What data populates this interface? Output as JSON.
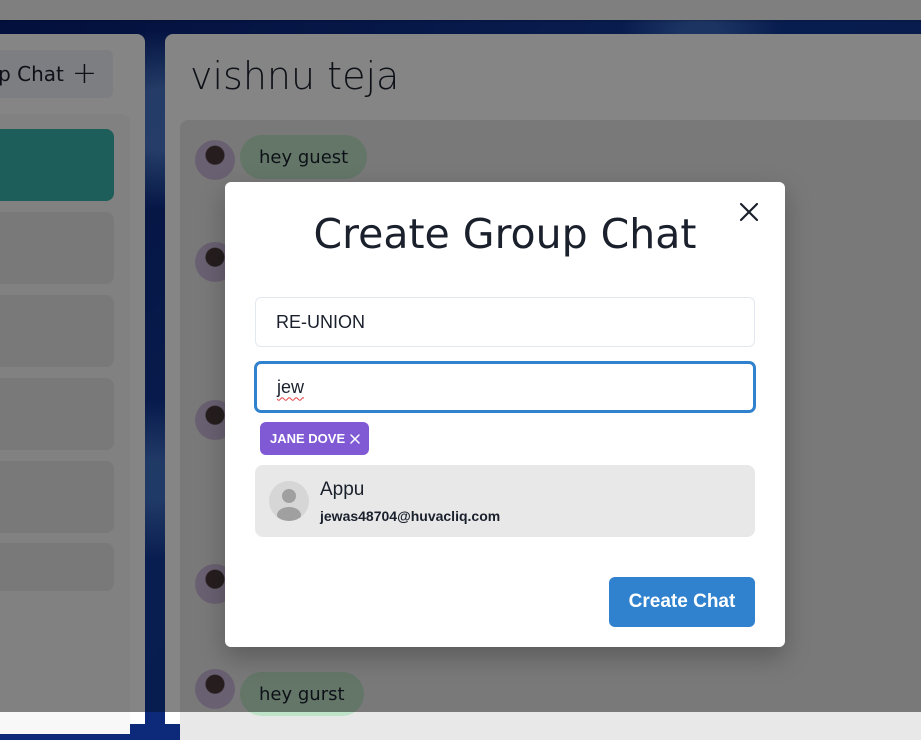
{
  "sidebar": {
    "new_group_label": "p Chat",
    "new_group_icon": "plus-icon"
  },
  "chat": {
    "title": "vishnu teja",
    "messages": [
      {
        "text": "hey guest"
      },
      {
        "text": "hey gurst"
      }
    ]
  },
  "modal": {
    "title": "Create Group Chat",
    "chat_name_value": "RE-UNION",
    "search_value": "jew",
    "selected_users": [
      {
        "label": "JANE DOVE"
      }
    ],
    "results": [
      {
        "name": "Appu",
        "email": "jewas48704@huvacliq.com"
      }
    ],
    "create_label": "Create Chat",
    "close_icon": "close-icon"
  },
  "colors": {
    "accent_blue": "#3182ce",
    "chip_purple": "#805ad5",
    "active_teal": "#38b2ac",
    "bubble_green": "#bee3c8"
  }
}
